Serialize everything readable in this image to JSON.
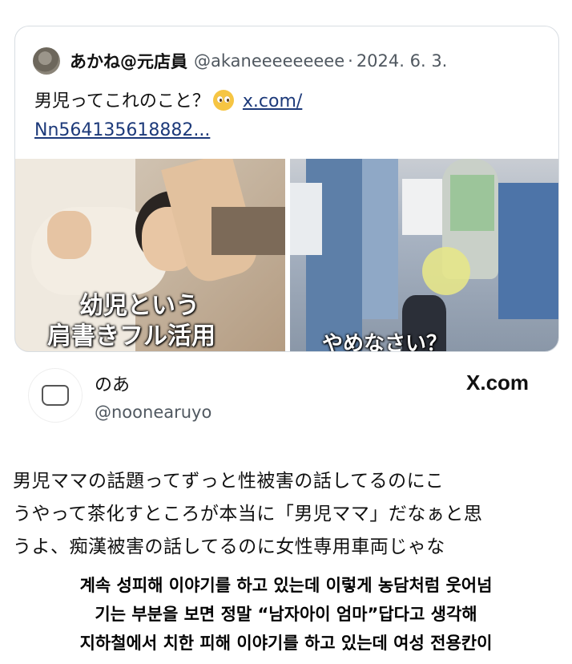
{
  "quote": {
    "name": "あかね@元店員",
    "handle": "@akaneeeeeeeee",
    "separator": "·",
    "date": "2024. 6. 3.",
    "text_before_emoji": "男児ってこれのこと？",
    "emoji": "pleading-face-emoji",
    "link_line1": "x.com/",
    "link_line2": "Nn564135618882..."
  },
  "media": {
    "left_overlay_line1": "幼児という",
    "left_overlay_line2": "肩書きフル活用",
    "right_overlay": "やめなさい？"
  },
  "profile": {
    "name": "のあ",
    "handle": "@noonearuyo",
    "source": "X.com",
    "avatar_icon": "cat-bowl-icon"
  },
  "post": {
    "lines": [
      "男児ママの話題ってずっと性被害の話してるのにこ",
      "うやって茶化すところが本当に「男児ママ」だなぁと思",
      "うよ、痴漢被害の話してるのに女性専用車両じゃな"
    ]
  },
  "caption": {
    "lines": [
      "계속 성피해 이야기를 하고 있는데 이렇게 농담처럼 웃어넘",
      "기는 부분을 보면 정말 “남자아이 엄마”답다고 생각해",
      "지하철에서 치한 피해 이야기를 하고 있는데 여성 전용칸이"
    ]
  },
  "colors": {
    "link": "#1d3a7a",
    "muted": "#505860",
    "border": "#d8dde2"
  }
}
